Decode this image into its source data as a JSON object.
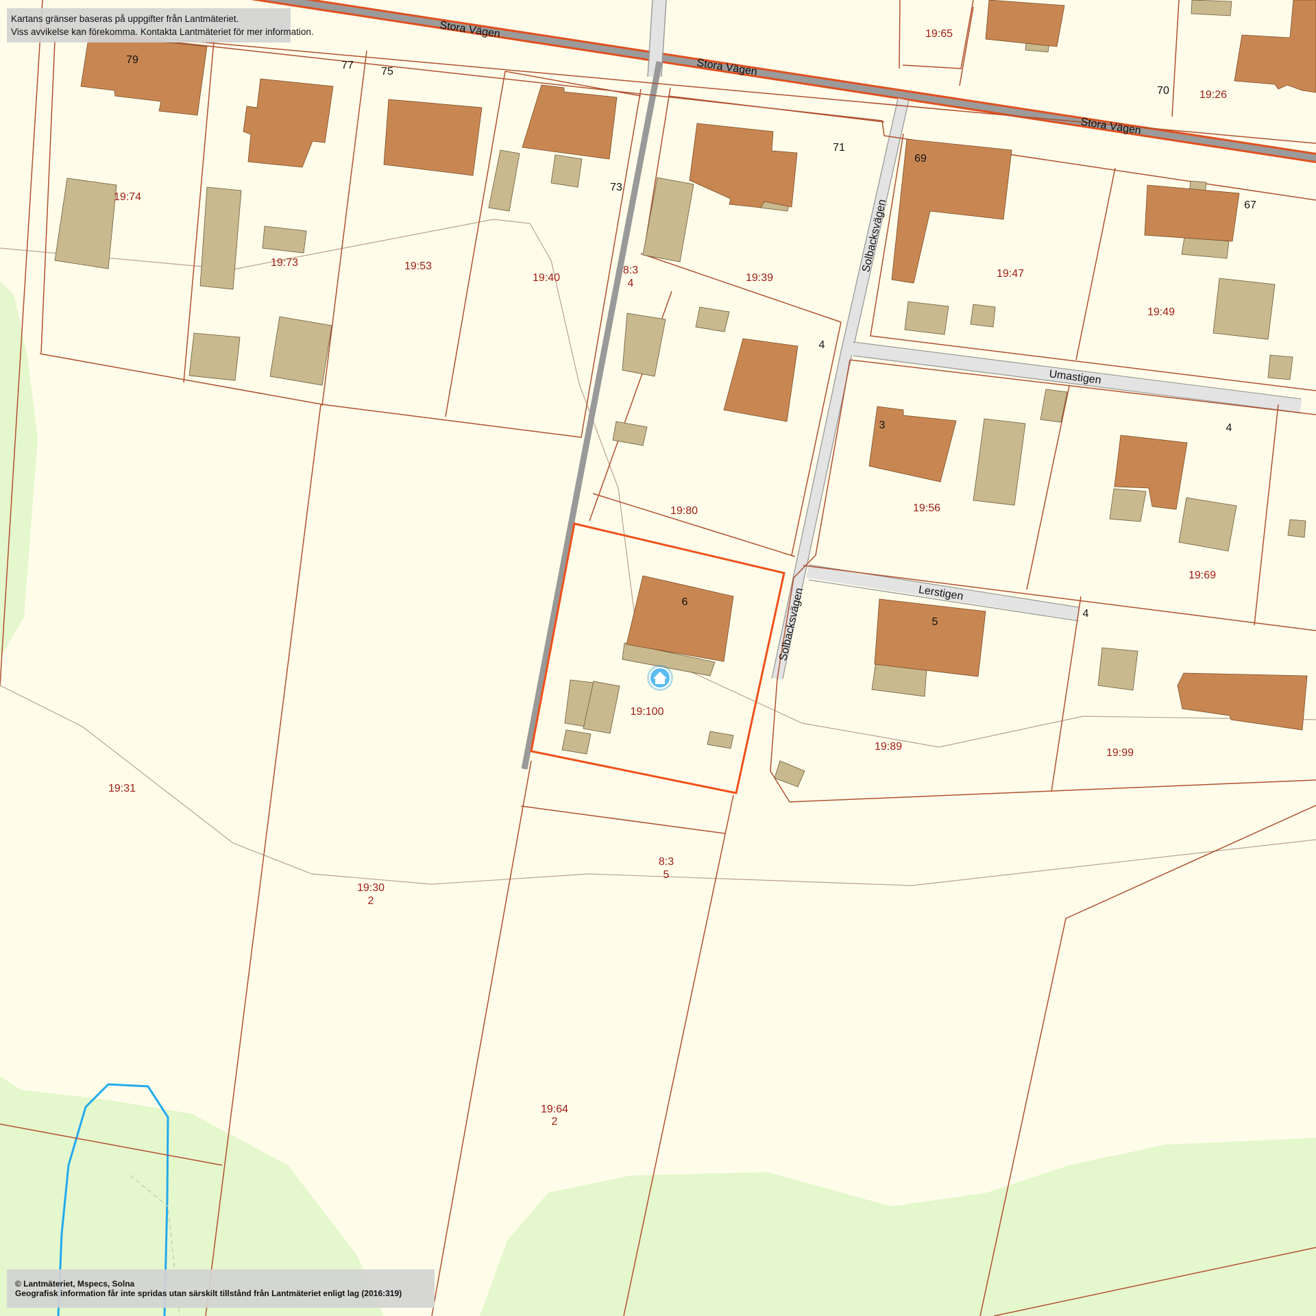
{
  "notices": {
    "top": [
      "Kartans gränser baseras på uppgifter från Lantmäteriet.",
      "Viss avvikelse kan förekomma. Kontakta Lantmäteriet för mer information."
    ],
    "bottom": [
      "© Lantmäteriet, Mspecs, Solna",
      "Geografisk information får inte spridas utan särskilt tillstånd från Lantmäteriet enligt lag (2016:319)"
    ]
  },
  "roads": {
    "stora_vagen_1": "Stora Vägen",
    "stora_vagen_2": "Stora Vägen",
    "stora_vagen_3": "Stora Vägen",
    "solbacksvagen_1": "Solbacksvägen",
    "solbacksvagen_2": "Solbacksvägen",
    "umastigen": "Umastigen",
    "lerstigen": "Lerstigen"
  },
  "parcels": {
    "p19_74": "19:74",
    "p19_73": "19:73",
    "p19_53": "19:53",
    "p19_40": "19:40",
    "p8_3_4a": "8:3",
    "p8_3_4b": "4",
    "p19_39": "19:39",
    "p19_47": "19:47",
    "p19_49": "19:49",
    "p19_65": "19:65",
    "p19_26": "19:26",
    "p19_80": "19:80",
    "p19_56": "19:56",
    "p19_69": "19:69",
    "p19_100": "19:100",
    "p19_89": "19:89",
    "p19_99": "19:99",
    "p19_31": "19:31",
    "p19_30a": "19:30",
    "p19_30b": "2",
    "p8_3_5a": "8:3",
    "p8_3_5b": "5",
    "p19_64a": "19:64",
    "p19_64b": "2"
  },
  "addresses": {
    "a79": "79",
    "a77": "77",
    "a75": "75",
    "a73": "73",
    "a71": "71",
    "a70": "70",
    "a69": "69",
    "a67": "67",
    "a4_solbacks": "4",
    "a3": "3",
    "a4_umastigen": "4",
    "a6": "6",
    "a5": "5",
    "a4_lerstigen": "4"
  },
  "colors": {
    "background": "#fffdea",
    "green_area": "#e5f7cc",
    "house": "#c88752",
    "outbuilding": "#c9b98e",
    "parcel_line": "#b0502f",
    "selected_parcel": "#f0501a",
    "road_fill": "#e3e3e3",
    "main_road_center": "#9b9b9b",
    "water_line": "#22aaee",
    "parcel_label": "#9e1a12"
  },
  "icons": {
    "selected_property": "house-marker-icon"
  }
}
